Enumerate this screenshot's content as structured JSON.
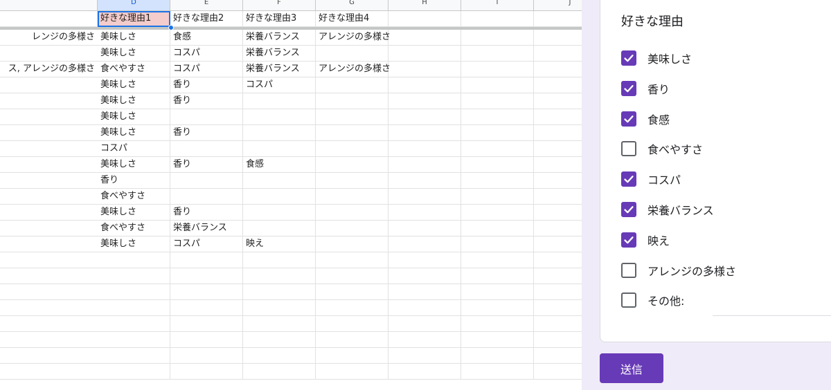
{
  "sheet": {
    "columns": [
      "D",
      "E",
      "F",
      "G",
      "H",
      "I",
      "J"
    ],
    "header_row": [
      "好きな理由1",
      "好きな理由2",
      "好きな理由3",
      "好きな理由4",
      "",
      ""
    ],
    "rows": [
      [
        "レンジの多様さ",
        "美味しさ",
        "食感",
        "栄養バランス",
        "アレンジの多様さ",
        "",
        ""
      ],
      [
        "",
        "美味しさ",
        "コスパ",
        "栄養バランス",
        "",
        "",
        ""
      ],
      [
        "ス, アレンジの多様さ",
        "食べやすさ",
        "コスパ",
        "栄養バランス",
        "アレンジの多様さ",
        "",
        ""
      ],
      [
        "",
        "美味しさ",
        "香り",
        "コスパ",
        "",
        "",
        ""
      ],
      [
        "",
        "美味しさ",
        "香り",
        "",
        "",
        "",
        ""
      ],
      [
        "",
        "美味しさ",
        "",
        "",
        "",
        "",
        ""
      ],
      [
        "",
        "美味しさ",
        "香り",
        "",
        "",
        "",
        ""
      ],
      [
        "",
        "コスパ",
        "",
        "",
        "",
        "",
        ""
      ],
      [
        "",
        "美味しさ",
        "香り",
        "食感",
        "",
        "",
        ""
      ],
      [
        "",
        "香り",
        "",
        "",
        "",
        "",
        ""
      ],
      [
        "",
        "食べやすさ",
        "",
        "",
        "",
        "",
        ""
      ],
      [
        "",
        "美味しさ",
        "香り",
        "",
        "",
        "",
        ""
      ],
      [
        "",
        "食べやすさ",
        "栄養バランス",
        "",
        "",
        "",
        ""
      ],
      [
        "",
        "美味しさ",
        "コスパ",
        "映え",
        "",
        "",
        ""
      ],
      [
        "",
        "",
        "",
        "",
        "",
        "",
        ""
      ],
      [
        "",
        "",
        "",
        "",
        "",
        "",
        ""
      ],
      [
        "",
        "",
        "",
        "",
        "",
        "",
        ""
      ],
      [
        "",
        "",
        "",
        "",
        "",
        "",
        ""
      ],
      [
        "",
        "",
        "",
        "",
        "",
        "",
        ""
      ],
      [
        "",
        "",
        "",
        "",
        "",
        "",
        ""
      ],
      [
        "",
        "",
        "",
        "",
        "",
        "",
        ""
      ],
      [
        "",
        "",
        "",
        "",
        "",
        "",
        ""
      ]
    ],
    "active_cell_color": "#f4cccc",
    "selection_color": "#1a73e8"
  },
  "form": {
    "question_title": "好きな理由",
    "options": [
      {
        "label": "美味しさ",
        "checked": true
      },
      {
        "label": "香り",
        "checked": true
      },
      {
        "label": "食感",
        "checked": true
      },
      {
        "label": "食べやすさ",
        "checked": false
      },
      {
        "label": "コスパ",
        "checked": true
      },
      {
        "label": "栄養バランス",
        "checked": true
      },
      {
        "label": "映え",
        "checked": true
      },
      {
        "label": "アレンジの多様さ",
        "checked": false
      },
      {
        "label": "その他:",
        "checked": false
      }
    ],
    "submit_label": "送信",
    "accent_color": "#673ab7",
    "background_color": "#f0ebf8",
    "check_icon": "checkmark-icon"
  }
}
